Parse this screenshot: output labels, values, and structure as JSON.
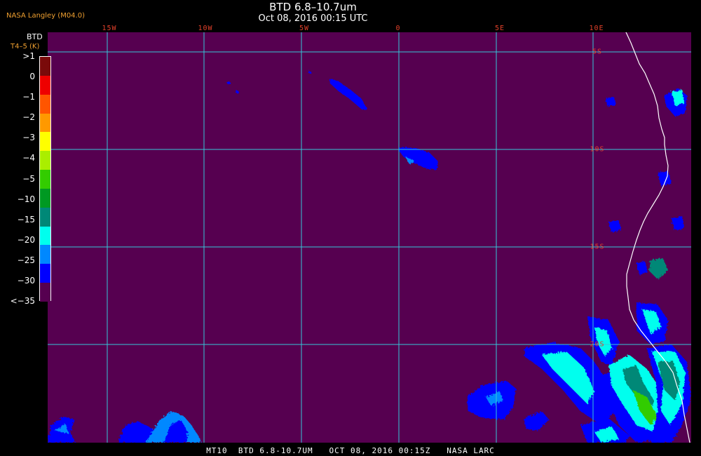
{
  "header": {
    "agency": "NASA Langley (M04.0)",
    "title": "BTD 6.8–10.7um",
    "datetime": "Oct 08, 2016 00:15 UTC"
  },
  "legend": {
    "title": "BTD",
    "units": "T4–5 (K)",
    "ticks": [
      ">1",
      "0",
      "−1",
      "−2",
      "−3",
      "−4",
      "−5",
      "−10",
      "−15",
      "−20",
      "−25",
      "−30",
      "<−35"
    ],
    "colors": [
      "#7a0a0a",
      "#ee0000",
      "#ff5500",
      "#ff9900",
      "#ffff00",
      "#aaee00",
      "#33cc00",
      "#009922",
      "#008877",
      "#00ffee",
      "#0088ff",
      "#0000ff",
      "#560050"
    ]
  },
  "map": {
    "lon_labels": [
      "15W",
      "10W",
      "5W",
      "0",
      "5E",
      "10E"
    ],
    "lat_labels": [
      "5S",
      "10S",
      "15S",
      "20S"
    ],
    "colors": {
      "background": "#560050",
      "grid": "#35c8d8",
      "coast": "#ffffff",
      "label": "#e0402a",
      "cloud_blue": "#0000ff",
      "cloud_light": "#0088ff",
      "cloud_cyan": "#00ffee",
      "cloud_teal": "#008877"
    }
  },
  "footer": {
    "text": "MT10  BTD 6.8-10.7UM   OCT 08, 2016 00:15Z   NASA LARC"
  }
}
